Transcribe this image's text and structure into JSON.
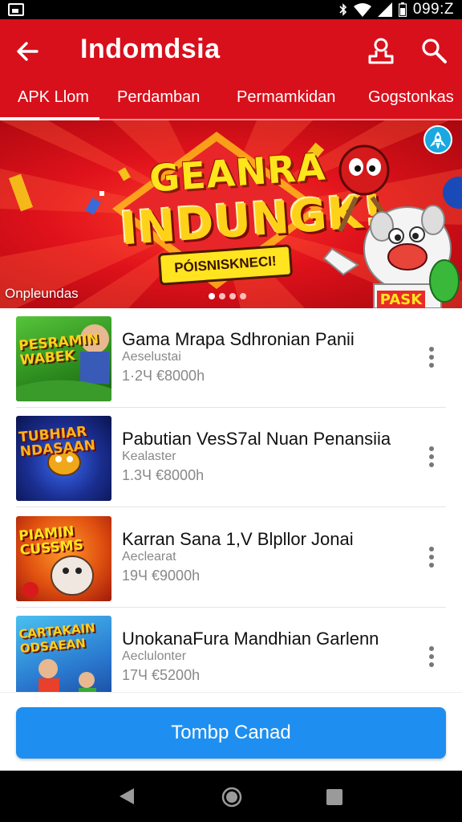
{
  "status_bar": {
    "time": "099:Z",
    "icons": [
      "image-icon",
      "bluetooth-icon",
      "wifi-icon",
      "signal-icon",
      "battery-icon"
    ]
  },
  "app_bar": {
    "title": "Indomdsia",
    "background_color": "#d8101c",
    "icons": [
      "back-arrow-icon",
      "user-icon",
      "search-icon"
    ]
  },
  "tabs": [
    {
      "label": "APK Llom",
      "active": true
    },
    {
      "label": "Perdamban",
      "active": false
    },
    {
      "label": "Permamkidan",
      "active": false
    },
    {
      "label": "Gogstonkas",
      "active": false
    }
  ],
  "banner": {
    "headline_line1": "GEANRA",
    "headline_line2": "INDUNGK!",
    "badge": "PÓISNISKNECI!",
    "caption": "Onpleundas",
    "mascot_label": "PASK",
    "dots": {
      "count": 4,
      "active_index": 0
    }
  },
  "games": [
    {
      "title": "Gama Mrapa Sdhronian Panii",
      "subtitle": "Aeselustai",
      "size": "1·2Ч €8000h",
      "thumb_text": "PESRAMIN WABEK",
      "thumb_colors": [
        "#3fae2a",
        "#1c6e1a"
      ],
      "thumb_text_color": "#ffd21a"
    },
    {
      "title": "Pabutian VesS7al Nuan Penansiia",
      "subtitle": "Kealaster",
      "size": "1.3Ч €8000h",
      "thumb_text": "TUBHIAR NDASAAN",
      "thumb_colors": [
        "#1a3aa8",
        "#0a1a5e"
      ],
      "thumb_text_color": "#ffb21a"
    },
    {
      "title": "Karran Sana 1,V Blpllor Jonai",
      "subtitle": "Aeclearat",
      "size": "19Ч €9000h",
      "thumb_text": "PIAMIN CUSSMS",
      "thumb_colors": [
        "#f07a14",
        "#c0300c"
      ],
      "thumb_text_color": "#ffe51c"
    },
    {
      "title": "UnokanaFura Mandhian Garlenn",
      "subtitle": "Aeclulonter",
      "size": "17Ч €5200h",
      "thumb_text": "CARTAKAIN ODSAEAN",
      "thumb_colors": [
        "#2aa8e8",
        "#1a5ec0"
      ],
      "thumb_text_color": "#ffcf1a"
    }
  ],
  "primary_button": {
    "label": "Tombp Canad",
    "color": "#1e8ff0"
  },
  "nav_bar": {
    "icons": [
      "nav-back-icon",
      "nav-home-icon",
      "nav-recent-icon"
    ]
  }
}
